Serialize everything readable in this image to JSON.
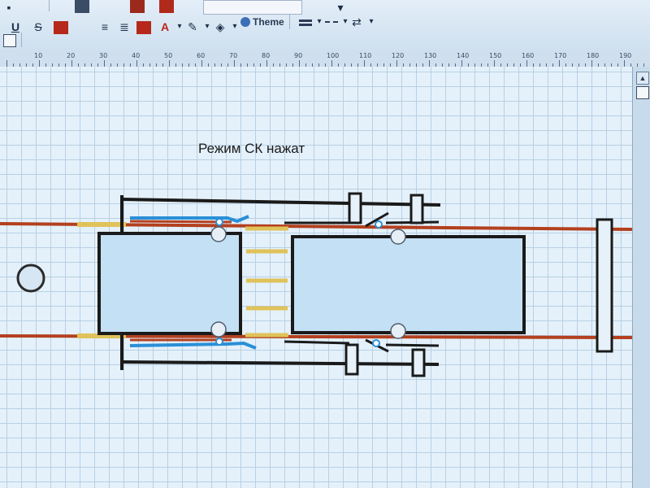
{
  "toolbar": {
    "theme_label": "Theme",
    "format_buttons": [
      {
        "name": "underline-icon",
        "glyph": "U"
      },
      {
        "name": "strikethrough-icon",
        "glyph": "S"
      }
    ],
    "font_color_glyph": "A",
    "dropdown_glyph": "▾",
    "accent_colors": [
      "#b6281a",
      "#1e5aa8",
      "#e2c34a"
    ]
  },
  "ruler": {
    "labels": [
      "10",
      "20",
      "30",
      "40",
      "50",
      "60",
      "70",
      "80",
      "90",
      "100",
      "110",
      "120",
      "130",
      "140",
      "150",
      "160",
      "170",
      "180",
      "190"
    ]
  },
  "canvas": {
    "mode_text": "Режим СК нажат",
    "colors": {
      "rail": "#b3401f",
      "yellow": "#e0c25a",
      "blue": "#2a8fd6",
      "black": "#1a1a1a",
      "box_fill": "#c3e0f4"
    }
  }
}
